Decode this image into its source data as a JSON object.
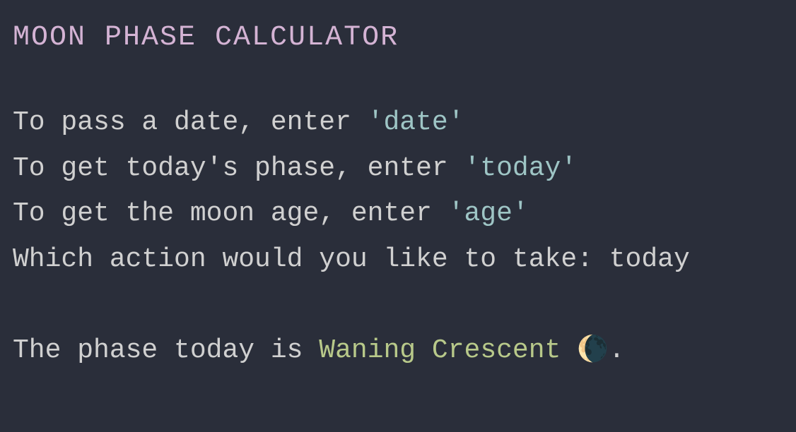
{
  "title": "MOON PHASE CALCULATOR",
  "instructions": {
    "date": {
      "prefix": "To pass a date, enter ",
      "literal": "'date'"
    },
    "today": {
      "prefix": "To get today's phase, enter ",
      "literal": "'today'"
    },
    "age": {
      "prefix": "To get the moon age, enter ",
      "literal": "'age'"
    }
  },
  "prompt": {
    "text": "Which action would you like to take: ",
    "input": "today"
  },
  "result": {
    "prefix": "The phase today is ",
    "phase": "Waning Crescent",
    "icon": "🌘",
    "suffix": "."
  }
}
